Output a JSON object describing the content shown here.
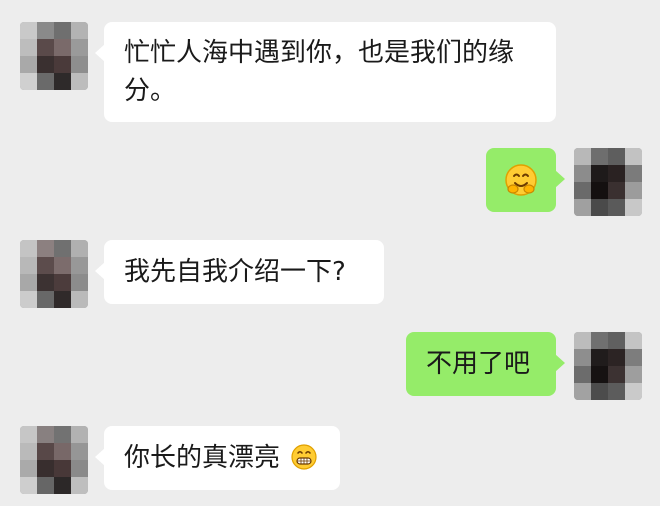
{
  "chat": {
    "messages": [
      {
        "side": "incoming",
        "text": "忙忙人海中遇到你，也是我们的缘分。"
      },
      {
        "side": "outgoing",
        "text": "",
        "emoji": "hugging-face-emoji"
      },
      {
        "side": "incoming",
        "text": "我先自我介绍一下?"
      },
      {
        "side": "outgoing",
        "text": "不用了吧"
      },
      {
        "side": "incoming",
        "text": "你长的真漂亮",
        "emoji": "grinning-face-emoji"
      }
    ]
  },
  "colors": {
    "background": "#ededed",
    "incoming_bubble": "#ffffff",
    "outgoing_bubble": "#95ec69",
    "text": "#1a1a1a"
  }
}
